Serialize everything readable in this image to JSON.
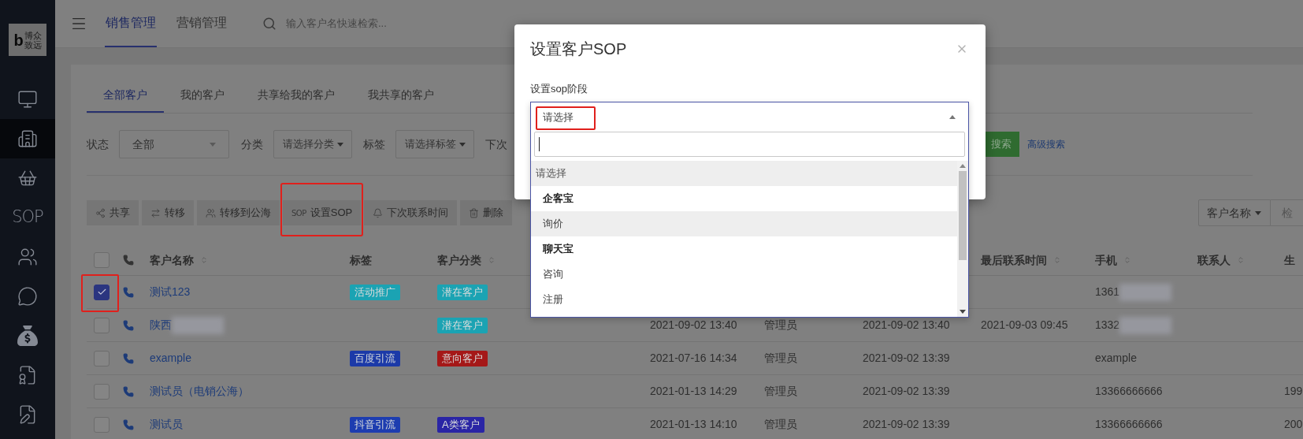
{
  "sidebar": {
    "logo": {
      "letter": "b",
      "lines": [
        "博众",
        "致远"
      ]
    },
    "items": [
      {
        "kind": "icon",
        "selected": false
      },
      {
        "kind": "icon",
        "selected": true
      },
      {
        "kind": "icon",
        "selected": false
      },
      {
        "kind": "text",
        "label": "SOP",
        "selected": false
      },
      {
        "kind": "icon",
        "selected": false
      },
      {
        "kind": "icon",
        "selected": false
      },
      {
        "kind": "icon",
        "selected": false
      },
      {
        "kind": "icon",
        "selected": false
      },
      {
        "kind": "icon",
        "selected": false
      }
    ]
  },
  "topbar": {
    "tabs": [
      {
        "label": "销售管理",
        "selected": true
      },
      {
        "label": "营销管理",
        "selected": false
      }
    ],
    "search": {
      "placeholder": "输入客户名快速检索..."
    }
  },
  "customer_tabs": [
    {
      "label": "全部客户",
      "selected": true
    },
    {
      "label": "我的客户",
      "selected": false
    },
    {
      "label": "共享给我的客户",
      "selected": false
    },
    {
      "label": "我共享的客户",
      "selected": false
    }
  ],
  "filters": [
    {
      "kind": "select",
      "label": "状态",
      "value": "全部"
    },
    {
      "kind": "dropdown",
      "label": "分类",
      "value": "请选择分类"
    },
    {
      "kind": "dropdown",
      "label": "标签",
      "value": "请选择标签"
    },
    {
      "kind": "label",
      "label": "下次"
    }
  ],
  "search_button": "搜索",
  "advanced_search": "高级搜索",
  "actions": [
    {
      "label": "共享",
      "highlighted": false
    },
    {
      "label": "转移",
      "highlighted": false
    },
    {
      "label": "转移到公海",
      "highlighted": false
    },
    {
      "label": "设置SOP",
      "icon_text": "SOP",
      "highlighted": true
    },
    {
      "label": "下次联系时间",
      "highlighted": false
    },
    {
      "label": "删除",
      "highlighted": false
    }
  ],
  "search_by": {
    "value": "客户名称",
    "placeholder": "检"
  },
  "table": {
    "select_all": {
      "checked": false
    },
    "columns": [
      {
        "label": "客户名称",
        "sortable": true
      },
      {
        "label": "标签",
        "sortable": false
      },
      {
        "label": "客户分类",
        "sortable": true
      },
      {
        "label": "最后联系时间",
        "sortable": true
      },
      {
        "label": "手机",
        "sortable": true
      },
      {
        "label": "联系人",
        "sortable": true
      },
      {
        "label": "生",
        "sortable": false
      }
    ],
    "rows": [
      {
        "checked": true,
        "highlighted": true,
        "name": "测试123",
        "name_redacted": false,
        "tag": {
          "label": "活动推广",
          "color": "#1ba3b3"
        },
        "category": {
          "label": "潜在客户",
          "color": "#1ba3b3"
        },
        "mobile": "1361",
        "mobile_redacted": true
      },
      {
        "checked": false,
        "highlighted": false,
        "name": "陕西",
        "name_redacted": true,
        "category": {
          "label": "潜在客户",
          "color": "#1ba3b3"
        },
        "created": "2021-09-02 13:40",
        "creator": "管理员",
        "updated": "2021-09-02 13:40",
        "last_contact": "2021-09-03 09:45",
        "mobile": "1332",
        "mobile_redacted": true
      },
      {
        "checked": false,
        "highlighted": false,
        "name": "example",
        "name_redacted": false,
        "tag": {
          "label": "百度引流",
          "color": "#1c3aa8"
        },
        "category": {
          "label": "意向客户",
          "color": "#a51818"
        },
        "created": "2021-07-16 14:34",
        "creator": "管理员",
        "updated": "2021-09-02 13:39",
        "mobile": "example",
        "mobile_redacted": false
      },
      {
        "checked": false,
        "highlighted": false,
        "name": "测试员（电销公海）",
        "name_redacted": false,
        "created": "2021-01-13 14:29",
        "creator": "管理员",
        "updated": "2021-09-02 13:39",
        "mobile": "13366666666",
        "mobile_redacted": false,
        "birthday": "199"
      },
      {
        "checked": false,
        "highlighted": false,
        "name": "测试员",
        "name_redacted": false,
        "tag": {
          "label": "抖音引流",
          "color": "#1d3db0"
        },
        "category": {
          "label": "A类客户",
          "color": "#2a25a5"
        },
        "created": "2021-01-13 14:10",
        "creator": "管理员",
        "updated": "2021-09-02 13:39",
        "mobile": "13366666666",
        "mobile_redacted": false,
        "birthday": "200"
      }
    ]
  },
  "modal": {
    "title": "设置客户SOP",
    "field_label": "设置sop阶段",
    "select": {
      "value": "请选择",
      "highlighted": true,
      "expanded": true
    },
    "options": [
      {
        "kind": "placeholder",
        "label": "请选择",
        "highlighted": true
      },
      {
        "kind": "group",
        "label": "企客宝",
        "highlighted": false
      },
      {
        "kind": "option",
        "label": "询价",
        "highlighted": true
      },
      {
        "kind": "group",
        "label": "聊天宝",
        "highlighted": false
      },
      {
        "kind": "option",
        "label": "咨询",
        "highlighted": false
      },
      {
        "kind": "option",
        "label": "注册",
        "highlighted": false
      }
    ]
  }
}
